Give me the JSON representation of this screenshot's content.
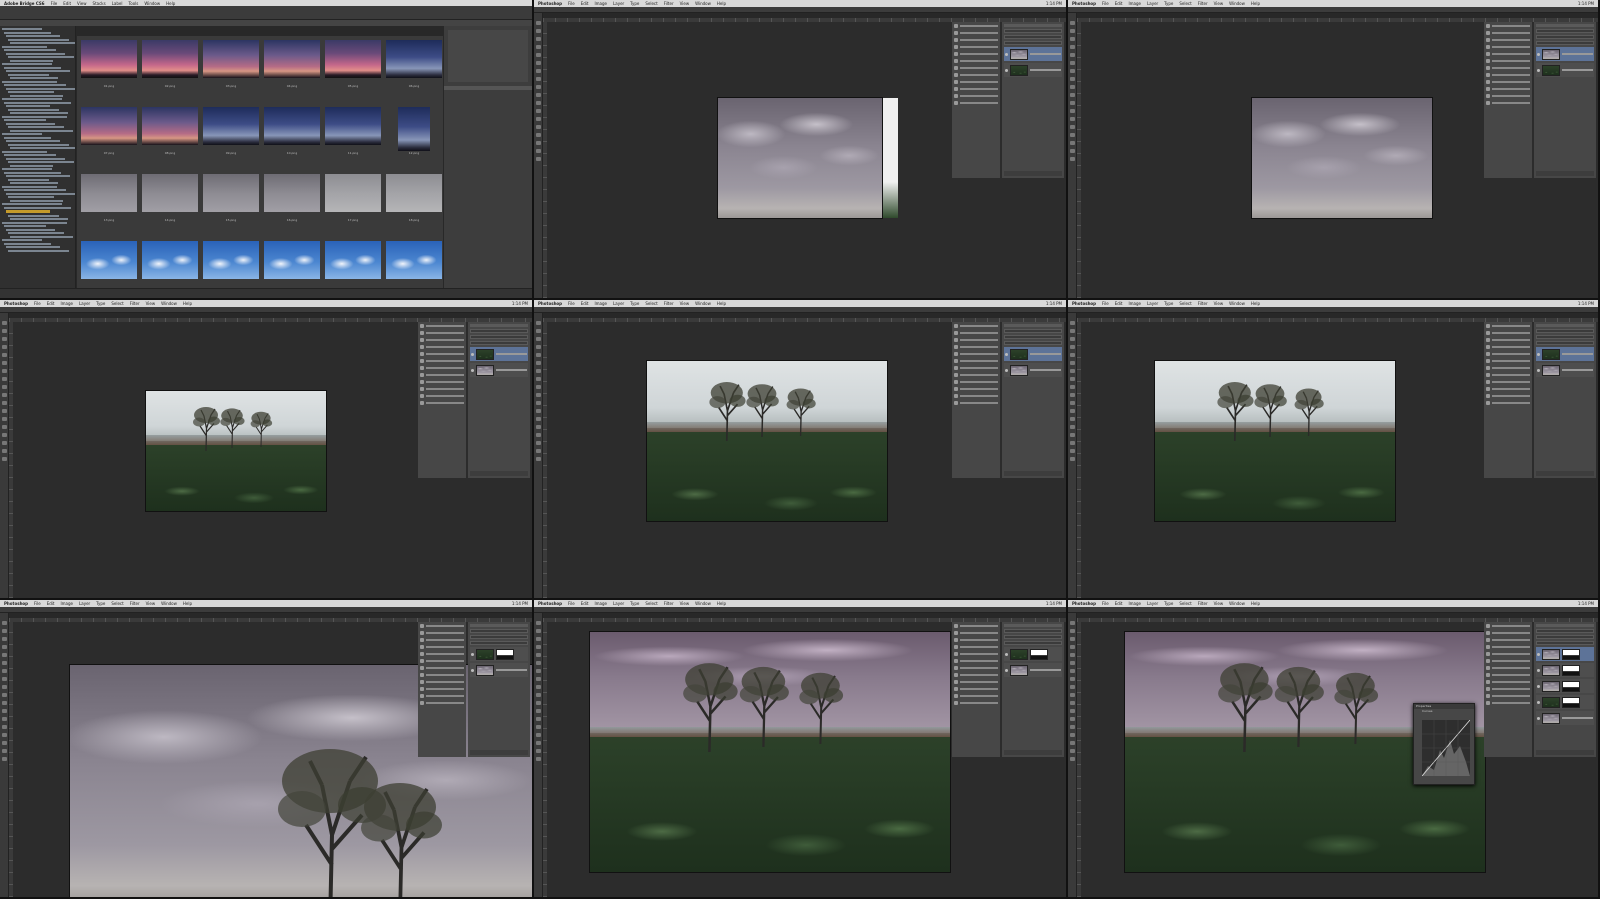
{
  "bridge": {
    "app_title": "Adobe Bridge CS6",
    "menus": [
      "File",
      "Edit",
      "View",
      "Stacks",
      "Label",
      "Tools",
      "Window",
      "Help"
    ],
    "thumbnails": [
      {
        "caption": "01.png",
        "style": "sunset1"
      },
      {
        "caption": "02.png",
        "style": "sunset1"
      },
      {
        "caption": "03.png",
        "style": "sunset2"
      },
      {
        "caption": "04.png",
        "style": "sunset2"
      },
      {
        "caption": "05.png",
        "style": "sunset1"
      },
      {
        "caption": "06.png",
        "style": "blue-eve"
      },
      {
        "caption": "07.png",
        "style": "sunset2"
      },
      {
        "caption": "08.png",
        "style": "sunset2"
      },
      {
        "caption": "09.png",
        "style": "blue-eve"
      },
      {
        "caption": "10.png",
        "style": "blue-eve"
      },
      {
        "caption": "11.png",
        "style": "blue-eve"
      },
      {
        "caption": "12.png",
        "style": "blue-eve"
      },
      {
        "caption": "13.png",
        "style": "overcast"
      },
      {
        "caption": "14.png",
        "style": "overcast"
      },
      {
        "caption": "15.png",
        "style": "overcast"
      },
      {
        "caption": "16.png",
        "style": "overcast"
      },
      {
        "caption": "17.png",
        "style": "overcast-lt"
      },
      {
        "caption": "18.png",
        "style": "overcast-lt"
      },
      {
        "caption": "",
        "style": "bluesky"
      },
      {
        "caption": "",
        "style": "bluesky"
      },
      {
        "caption": "",
        "style": "bluesky"
      },
      {
        "caption": "",
        "style": "bluesky"
      },
      {
        "caption": "",
        "style": "bluesky"
      },
      {
        "caption": "",
        "style": "bluesky"
      }
    ]
  },
  "photoshop": {
    "app_name": "Photoshop",
    "menus": [
      "File",
      "Edit",
      "Image",
      "Layer",
      "Type",
      "Select",
      "Filter",
      "View",
      "Window",
      "Help"
    ],
    "clock": "1:14 PM"
  },
  "curves_dialog": {
    "title": "Properties",
    "preset_label": "Curves"
  },
  "colors": {
    "layer_selected": "#5d7398",
    "bridge_folder_selected": "#c49a2a"
  }
}
